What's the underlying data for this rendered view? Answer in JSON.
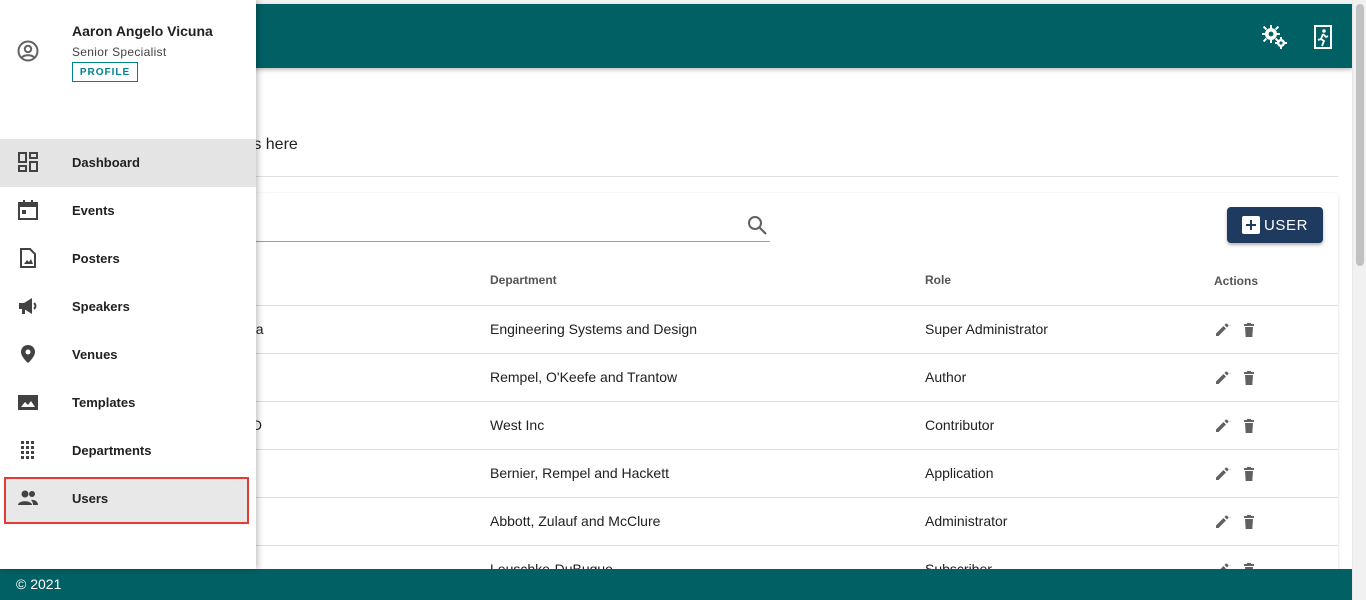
{
  "user": {
    "name": "Aaron Angelo Vicuna",
    "role": "Senior Specialist",
    "profile_label": "PROFILE"
  },
  "nav": {
    "items": [
      {
        "label": "Dashboard",
        "icon": "dashboard-icon"
      },
      {
        "label": "Events",
        "icon": "calendar-icon"
      },
      {
        "label": "Posters",
        "icon": "image-file-icon"
      },
      {
        "label": "Speakers",
        "icon": "megaphone-icon"
      },
      {
        "label": "Venues",
        "icon": "location-pin-icon"
      },
      {
        "label": "Templates",
        "icon": "landscape-image-icon"
      },
      {
        "label": "Departments",
        "icon": "building-icon"
      },
      {
        "label": "Users",
        "icon": "people-icon"
      }
    ],
    "active": "Dashboard",
    "highlighted": "Users"
  },
  "page": {
    "subtitle_fragment": "rs here"
  },
  "toolbar": {
    "add_user_label": "USER"
  },
  "table": {
    "headers": {
      "department": "Department",
      "role": "Role",
      "actions": "Actions"
    },
    "rows": [
      {
        "name_fragment": "na",
        "department": "Engineering Systems and Design",
        "role": "Super Administrator"
      },
      {
        "name_fragment": "",
        "department": "Rempel, O'Keefe and Trantow",
        "role": "Author"
      },
      {
        "name_fragment": "ID",
        "department": "West Inc",
        "role": "Contributor"
      },
      {
        "name_fragment": "",
        "department": "Bernier, Rempel and Hackett",
        "role": "Application"
      },
      {
        "name_fragment": "",
        "department": "Abbott, Zulauf and McClure",
        "role": "Administrator"
      },
      {
        "name_fragment": "",
        "department": "Leuschke-DuBuque",
        "role": "Subscriber"
      }
    ]
  },
  "footer": {
    "copyright": "© 2021"
  },
  "colors": {
    "appbar": "#006064",
    "button": "#1e3a5f",
    "highlight_border": "#e53935"
  }
}
